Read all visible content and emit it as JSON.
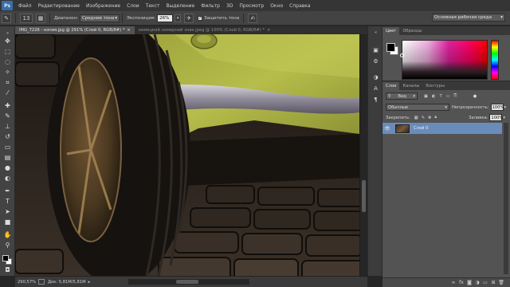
{
  "menu": {
    "logo": "Ps",
    "items": [
      "Файл",
      "Редактирование",
      "Изображение",
      "Слои",
      "Текст",
      "Выделение",
      "Фильтр",
      "3D",
      "Просмотр",
      "Окно",
      "Справка"
    ]
  },
  "options": {
    "brush_size": "13",
    "range_label": "Диапазон:",
    "range_value": "Средние тона",
    "exposure_label": "Экспозиция:",
    "exposure_value": "26%",
    "protect_label": "Защитить тона",
    "workspace": "Основная рабочая среда"
  },
  "tabs": [
    {
      "label": "IMG_7226 - копия.jpg @ 291% (Слой 0, RGB/8#) *",
      "close": "×"
    },
    {
      "label": "немецкий номерной знак.jpeg @ 100% (Слой 0, RGB/8#) *",
      "close": "×"
    }
  ],
  "status": {
    "zoom": "290,57%",
    "doc": "Док: 5,81M/5,81M"
  },
  "color_panel": {
    "tabs": [
      "Цвет",
      "Образцы"
    ],
    "colors": {
      "foreground": "#000000",
      "background": "#ffffff"
    }
  },
  "layers_panel": {
    "tabs": [
      "Слои",
      "Каналы",
      "Контуры"
    ],
    "filter": "Вид",
    "blend_mode": "Обычные",
    "opacity_label": "Непрозрачность:",
    "opacity_value": "100%",
    "lock_label": "Закрепить:",
    "fill_label": "Заливка:",
    "fill_value": "100%",
    "layers": [
      {
        "name": "Слой 0",
        "visible": true
      }
    ]
  },
  "accent": "#6a8cba"
}
